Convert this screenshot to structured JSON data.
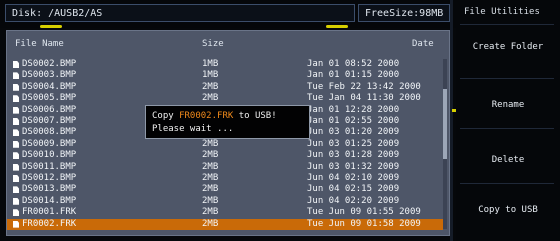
{
  "toolbar": {
    "path_label": "Disk: /AUSB2/AS",
    "free_size_label": "FreeSize:98MB"
  },
  "file_list": {
    "headers": {
      "name": "File Name",
      "size": "Size",
      "date": "Date"
    },
    "rows": [
      {
        "name": "DS0002.BMP",
        "size": "1MB",
        "date": "Jan 01 08:52 2000",
        "selected": false
      },
      {
        "name": "DS0003.BMP",
        "size": "1MB",
        "date": "Jan 01 01:15 2000",
        "selected": false
      },
      {
        "name": "DS0004.BMP",
        "size": "2MB",
        "date": "Tue Feb 22 13:42 2000",
        "selected": false
      },
      {
        "name": "DS0005.BMP",
        "size": "2MB",
        "date": "Tue Jan 04 11:30 2000",
        "selected": false
      },
      {
        "name": "DS0006.BMP",
        "size": "2MB",
        "date": "Jan 01 12:28 2000",
        "selected": false
      },
      {
        "name": "DS0007.BMP",
        "size": "2MB",
        "date": "Jan 01 02:55 2000",
        "selected": false
      },
      {
        "name": "DS0008.BMP",
        "size": "2MB",
        "date": "Jun 03 01:20 2009",
        "selected": false
      },
      {
        "name": "DS0009.BMP",
        "size": "2MB",
        "date": "Jun 03 01:25 2009",
        "selected": false
      },
      {
        "name": "DS0010.BMP",
        "size": "2MB",
        "date": "Jun 03 01:28 2009",
        "selected": false
      },
      {
        "name": "DS0011.BMP",
        "size": "2MB",
        "date": "Jun 03 01:32 2009",
        "selected": false
      },
      {
        "name": "DS0012.BMP",
        "size": "2MB",
        "date": "Jun 04 02:10 2009",
        "selected": false
      },
      {
        "name": "DS0013.BMP",
        "size": "2MB",
        "date": "Jun 04 02:15 2009",
        "selected": false
      },
      {
        "name": "DS0014.BMP",
        "size": "2MB",
        "date": "Jun 04 02:20 2009",
        "selected": false
      },
      {
        "name": "FR0001.FRK",
        "size": "2MB",
        "date": "Tue Jun 09 01:55 2009",
        "selected": false
      },
      {
        "name": "FR0002.FRK",
        "size": "2MB",
        "date": "Tue Jun 09 01:58 2009",
        "selected": true
      }
    ],
    "scroll_fraction": 0.3
  },
  "dialog": {
    "line1_prefix": "Copy ",
    "line1_file": "FR0002.FRK",
    "line1_suffix": " to USB!",
    "line2": "Please wait ..."
  },
  "side_menu": {
    "title": "File Utilities",
    "buttons": [
      "Create Folder",
      "Rename",
      "Delete",
      "Copy to USB"
    ]
  },
  "colors": {
    "accent_selected_row": "#c96a08",
    "trace_yellow": "#d7d000",
    "highlight_text": "#f08a1c"
  }
}
